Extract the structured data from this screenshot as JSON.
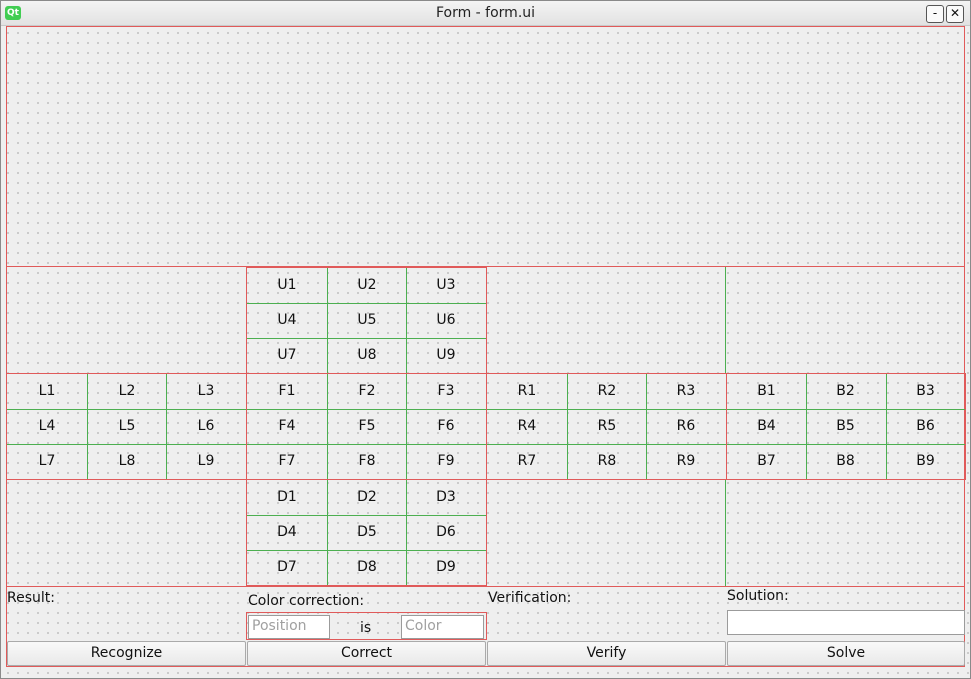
{
  "window": {
    "title": "Form - form.ui",
    "icon_text": "Qt",
    "minimize_label": "-",
    "close_label": "✕"
  },
  "faces": {
    "up": [
      "U1",
      "U2",
      "U3",
      "U4",
      "U5",
      "U6",
      "U7",
      "U8",
      "U9"
    ],
    "left": [
      "L1",
      "L2",
      "L3",
      "L4",
      "L5",
      "L6",
      "L7",
      "L8",
      "L9"
    ],
    "front": [
      "F1",
      "F2",
      "F3",
      "F4",
      "F5",
      "F6",
      "F7",
      "F8",
      "F9"
    ],
    "right": [
      "R1",
      "R2",
      "R3",
      "R4",
      "R5",
      "R6",
      "R7",
      "R8",
      "R9"
    ],
    "back": [
      "B1",
      "B2",
      "B3",
      "B4",
      "B5",
      "B6",
      "B7",
      "B8",
      "B9"
    ],
    "down": [
      "D1",
      "D2",
      "D3",
      "D4",
      "D5",
      "D6",
      "D7",
      "D8",
      "D9"
    ]
  },
  "bottom": {
    "result_label": "Result:",
    "color_correction_label": "Color correction:",
    "position_placeholder": "Position",
    "is_label": "is",
    "color_placeholder": "Color",
    "verification_label": "Verification:",
    "solution_label": "Solution:",
    "solution_value": "",
    "recognize_button": "Recognize",
    "correct_button": "Correct",
    "verify_button": "Verify",
    "solve_button": "Solve"
  }
}
